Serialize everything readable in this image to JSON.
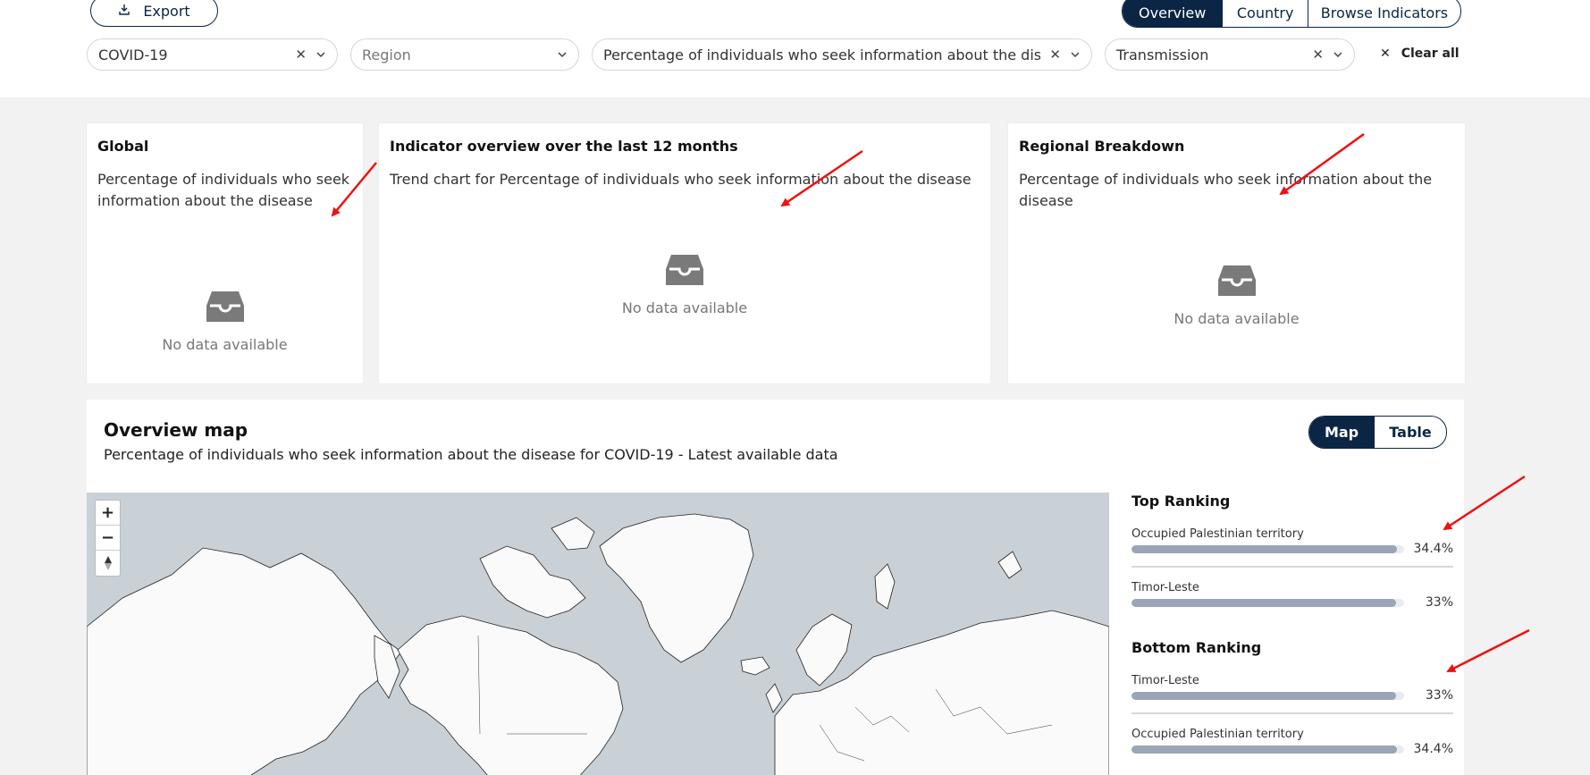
{
  "toolbar": {
    "export_label": "Export"
  },
  "nav_tabs": [
    {
      "label": "Overview",
      "active": true
    },
    {
      "label": "Country",
      "active": false
    },
    {
      "label": "Browse Indicators",
      "active": false
    }
  ],
  "filters": {
    "disease": "COVID-19",
    "region_placeholder": "Region",
    "indicator": "Percentage of individuals who seek information about the diseas",
    "category": "Transmission",
    "clear_all": "Clear all"
  },
  "cards": {
    "global": {
      "title": "Global",
      "desc_line1": "Percentage of individuals who seek",
      "desc_line2": "information about the disease",
      "empty": "No data available"
    },
    "trend": {
      "title": "Indicator overview over the last 12 months",
      "desc": "Trend chart for Percentage of individuals who seek information about the disease",
      "empty": "No data available"
    },
    "regional": {
      "title": "Regional Breakdown",
      "desc_line1": "Percentage of individuals who seek information about the",
      "desc_line2": "disease",
      "empty": "No data available"
    }
  },
  "map_section": {
    "title": "Overview map",
    "subtitle": "Percentage of individuals who seek information about the disease for COVID-19 - Latest available data",
    "view_tabs": [
      {
        "label": "Map",
        "active": true
      },
      {
        "label": "Table",
        "active": false
      }
    ],
    "zoom_in": "+",
    "zoom_out": "−"
  },
  "top_ranking": {
    "title": "Top Ranking",
    "items": [
      {
        "name": "Occupied Palestinian territory",
        "value": "34.4%",
        "fraction": 0.974
      },
      {
        "name": "Timor-Leste",
        "value": "33%",
        "fraction": 0.97
      }
    ]
  },
  "bottom_ranking": {
    "title": "Bottom Ranking",
    "items": [
      {
        "name": "Timor-Leste",
        "value": "33%",
        "fraction": 0.97
      },
      {
        "name": "Occupied Palestinian territory",
        "value": "34.4%",
        "fraction": 0.974
      }
    ]
  },
  "colors": {
    "primary": "#0b2545",
    "bar_fill": "#9aa6b6",
    "annotation_arrow": "#ee1111",
    "ocean": "#c9d1d6",
    "land": "#fafafa"
  }
}
